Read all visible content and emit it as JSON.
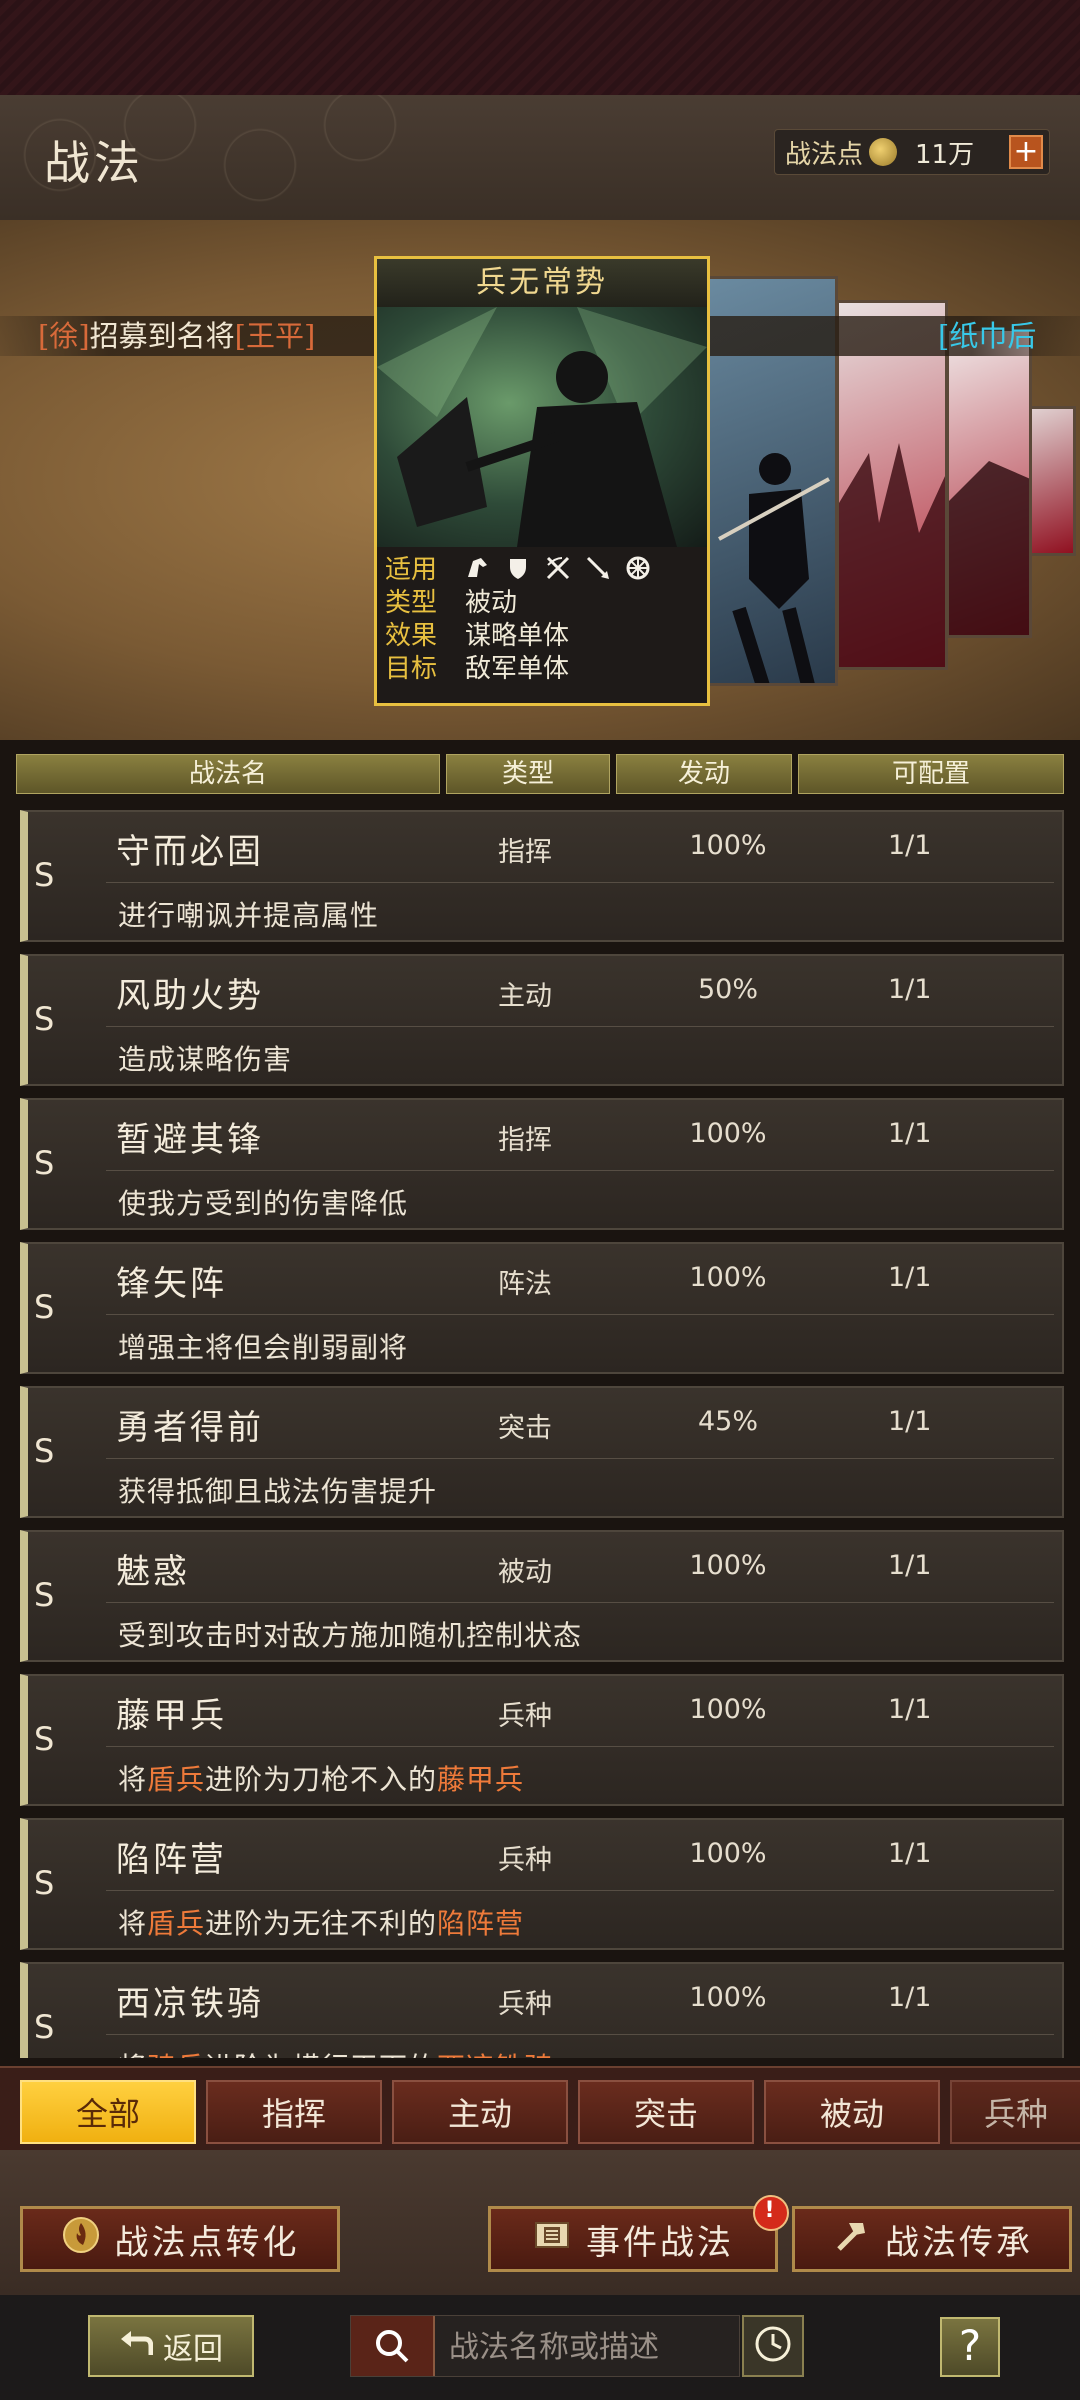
{
  "header": {
    "title": "战法",
    "points_label": "战法点",
    "points_value": "11万",
    "plus_label": "+"
  },
  "ticker": {
    "left_prefix": "[徐]",
    "left_text": "招募到名将",
    "left_hero": "[王平]",
    "right_text": "[纸巾后"
  },
  "featured": {
    "title": "兵无常势",
    "rows": [
      {
        "key": "适用",
        "value": ""
      },
      {
        "key": "类型",
        "value": "被动"
      },
      {
        "key": "效果",
        "value": "谋略单体"
      },
      {
        "key": "目标",
        "value": "敌军单体"
      }
    ],
    "apply_icons": [
      "cavalry-icon",
      "shield-icon",
      "crossbow-icon",
      "spear-icon",
      "chariot-icon"
    ]
  },
  "table": {
    "headers": [
      "战法名",
      "类型",
      "发动",
      "可配置"
    ]
  },
  "skills": [
    {
      "grade": "S",
      "name": "守而必固",
      "type": "指挥",
      "rate": "100%",
      "slots": "1/1",
      "desc": [
        {
          "t": "进行嘲讽并提高属性",
          "hl": false
        }
      ]
    },
    {
      "grade": "S",
      "name": "风助火势",
      "type": "主动",
      "rate": "50%",
      "slots": "1/1",
      "desc": [
        {
          "t": "造成谋略伤害",
          "hl": false
        }
      ]
    },
    {
      "grade": "S",
      "name": "暂避其锋",
      "type": "指挥",
      "rate": "100%",
      "slots": "1/1",
      "desc": [
        {
          "t": "使我方受到的伤害降低",
          "hl": false
        }
      ]
    },
    {
      "grade": "S",
      "name": "锋矢阵",
      "type": "阵法",
      "rate": "100%",
      "slots": "1/1",
      "desc": [
        {
          "t": "增强主将但会削弱副将",
          "hl": false
        }
      ]
    },
    {
      "grade": "S",
      "name": "勇者得前",
      "type": "突击",
      "rate": "45%",
      "slots": "1/1",
      "desc": [
        {
          "t": "获得抵御且战法伤害提升",
          "hl": false
        }
      ]
    },
    {
      "grade": "S",
      "name": "魅惑",
      "type": "被动",
      "rate": "100%",
      "slots": "1/1",
      "desc": [
        {
          "t": "受到攻击时对敌方施加随机控制状态",
          "hl": false
        }
      ]
    },
    {
      "grade": "S",
      "name": "藤甲兵",
      "type": "兵种",
      "rate": "100%",
      "slots": "1/1",
      "desc": [
        {
          "t": "将",
          "hl": false
        },
        {
          "t": "盾兵",
          "hl": true
        },
        {
          "t": "进阶为刀枪不入的",
          "hl": false
        },
        {
          "t": "藤甲兵",
          "hl": true
        }
      ]
    },
    {
      "grade": "S",
      "name": "陷阵营",
      "type": "兵种",
      "rate": "100%",
      "slots": "1/1",
      "desc": [
        {
          "t": "将",
          "hl": false
        },
        {
          "t": "盾兵",
          "hl": true
        },
        {
          "t": "进阶为无往不利的",
          "hl": false
        },
        {
          "t": "陷阵营",
          "hl": true
        }
      ]
    },
    {
      "grade": "S",
      "name": "西凉铁骑",
      "type": "兵种",
      "rate": "100%",
      "slots": "1/1",
      "desc": [
        {
          "t": "将",
          "hl": false
        },
        {
          "t": "骑兵",
          "hl": true
        },
        {
          "t": "进阶为横行天下的",
          "hl": false
        },
        {
          "t": "西凉铁骑",
          "hl": true
        }
      ]
    }
  ],
  "filters": [
    "全部",
    "指挥",
    "主动",
    "突击",
    "被动",
    "兵种"
  ],
  "actions": {
    "convert": "战法点转化",
    "event": "事件战法",
    "event_alert": "!",
    "inherit": "战法传承"
  },
  "bottom": {
    "back": "返回",
    "search_placeholder": "战法名称或描述",
    "help": "?"
  },
  "colors": {
    "accent_gold": "#e8c040",
    "highlight_orange": "#ee7a3a",
    "active_tab": "#ffd040",
    "ticker_cyan": "#38c8e8"
  }
}
